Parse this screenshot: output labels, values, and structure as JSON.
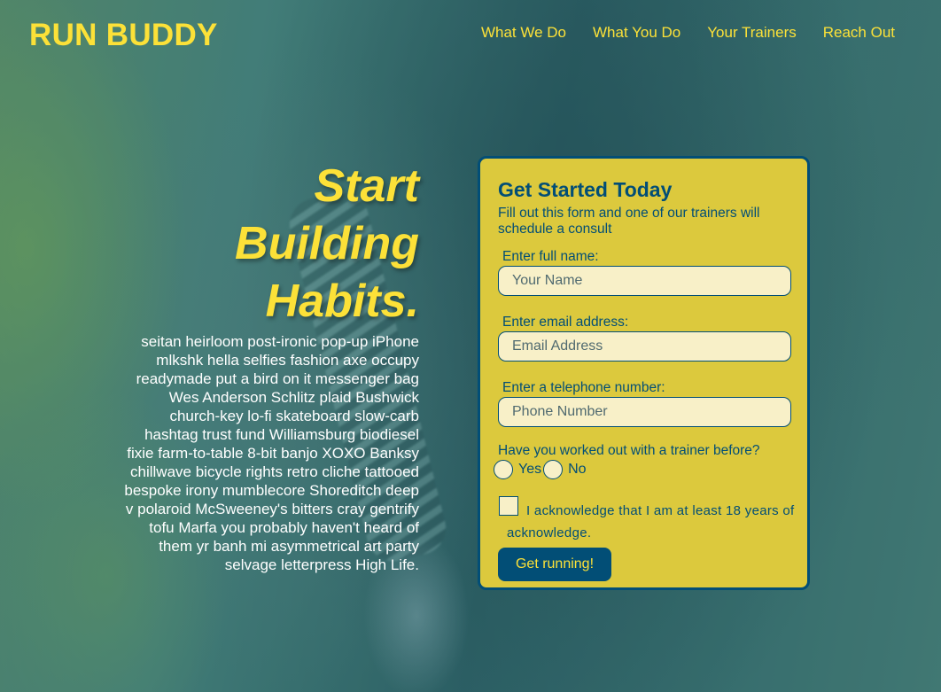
{
  "header": {
    "logo": "RUN BUDDY",
    "nav": [
      "What We Do",
      "What You Do",
      "Your Trainers",
      "Reach Out"
    ]
  },
  "hero": {
    "title_lines": [
      "Start",
      "Building",
      "Habits."
    ],
    "text": "seitan heirloom post-ironic pop-up iPhone mlkshk hella selfies fashion axe occupy readymade put a bird on it messenger bag Wes Anderson Schlitz plaid Bushwick church-key lo-fi skateboard slow-carb hashtag trust fund Williamsburg biodiesel fixie farm-to-table 8-bit banjo XOXO Banksy chillwave bicycle rights retro cliche tattooed bespoke irony mumblecore Shoreditch deep v polaroid McSweeney's bitters cray gentrify tofu Marfa you probably haven't heard of them yr banh mi asymmetrical art party selvage letterpress High Life."
  },
  "form": {
    "title": "Get Started Today",
    "subtitle": "Fill out this form and one of our trainers will schedule a consult",
    "name_label": "Enter full name:",
    "name_placeholder": "Your Name",
    "email_label": "Enter email address:",
    "email_placeholder": "Email Address",
    "phone_label": "Enter a telephone number:",
    "phone_placeholder": "Phone Number",
    "radio_question": "Have you worked out with a trainer before?",
    "radio_yes": "Yes",
    "radio_no": "No",
    "acknowledge_text": "I acknowledge that I am at least 18 years of acknowledge.",
    "submit_label": "Get running!"
  },
  "colors": {
    "accent_yellow": "#fce138",
    "brand_blue": "#024e76",
    "card_yellow": "#dcc93d"
  }
}
